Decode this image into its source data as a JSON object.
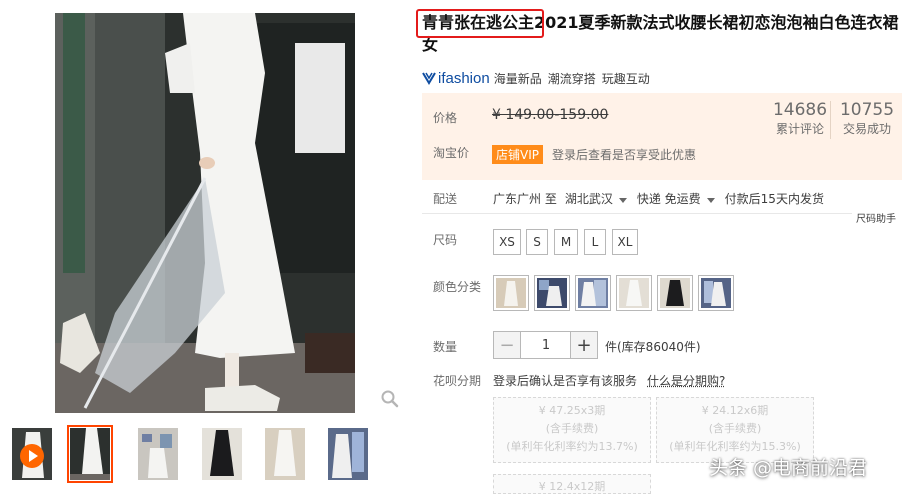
{
  "product": {
    "title": "青青张在逃公主2021夏季新款法式收腰长裙初恋泡泡袖白色连衣裙女",
    "brand_logo_text": "ifashion",
    "brand_tags": [
      "海量新品",
      "潮流穿搭",
      "玩趣互动"
    ]
  },
  "price_panel": {
    "price_label": "价格",
    "price_range": "¥ 149.00-159.00",
    "tb_price_label": "淘宝价",
    "vip_badge": "店铺VIP",
    "vip_note": "登录后查看是否享受此优惠",
    "reviews_count": "14686",
    "reviews_label": "累计评论",
    "sales_count": "10755",
    "sales_label": "交易成功"
  },
  "shipping": {
    "label": "配送",
    "from": "广东广州 至",
    "to": "湖北武汉",
    "method": "快递 免运费",
    "promise": "付款后15天内发货"
  },
  "size_helper": "尺码助手",
  "size": {
    "label": "尺码",
    "options": [
      "XS",
      "S",
      "M",
      "L",
      "XL"
    ]
  },
  "color": {
    "label": "颜色分类"
  },
  "quantity": {
    "label": "数量",
    "minus": "−",
    "value": "1",
    "plus": "+",
    "stock": "件(库存86040件)"
  },
  "huabei": {
    "label": "花呗分期",
    "note": "登录后确认是否享有该服务",
    "link": "什么是分期购?",
    "plans": [
      {
        "amount": "¥ 47.25x3期",
        "fee": "(含手续费)",
        "rate": "(单利年化利率约为13.7%)"
      },
      {
        "amount": "¥ 24.12x6期",
        "fee": "(含手续费)",
        "rate": "(单利年化利率约为15.3%)"
      },
      {
        "amount": "¥ 12.4x12期",
        "fee": "",
        "rate": ""
      }
    ]
  },
  "watermark": "头条 @电商前沿君",
  "colors": {
    "accent": "#ff4400",
    "highlight_box": "#e31b1b",
    "price_bg": "#fff2e8",
    "vip_orange": "#ff8c1a",
    "brand_blue": "#0f4da1"
  },
  "icons": {
    "zoom": "search-icon",
    "video": "play-icon",
    "brand": "ifashion-logo-icon"
  }
}
